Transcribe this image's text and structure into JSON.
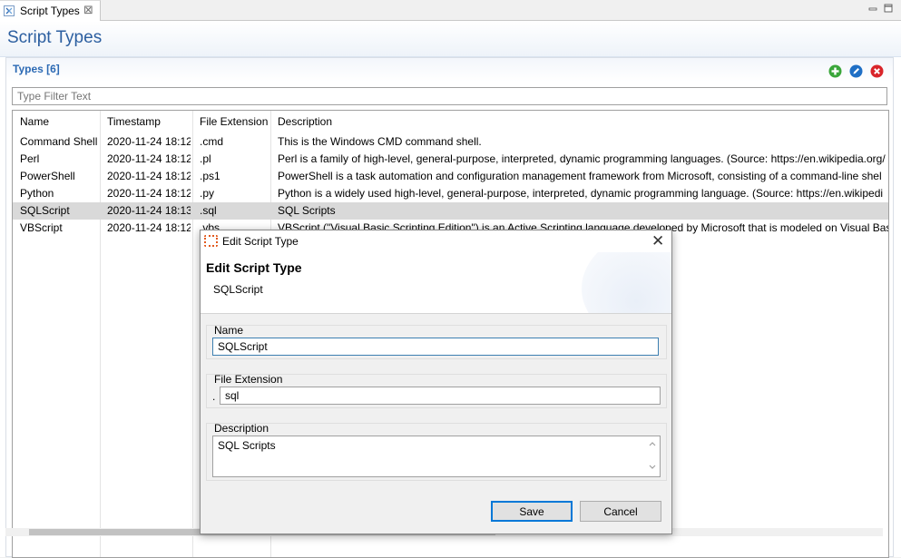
{
  "tab": {
    "label": "Script Types",
    "close_glyph": "⊠"
  },
  "page": {
    "title": "Script Types"
  },
  "section": {
    "title": "Types [6]"
  },
  "filter": {
    "placeholder": "Type Filter Text",
    "value": ""
  },
  "toolbar": {
    "add_icon": "plus-circle-icon",
    "edit_icon": "edit-icon",
    "delete_icon": "delete-icon",
    "colors": {
      "add": "#3aa63a",
      "edit": "#1f6fc5",
      "delete": "#d9252a"
    }
  },
  "table": {
    "columns": [
      "Name",
      "Timestamp",
      "File Extension",
      "Description"
    ],
    "rows": [
      {
        "name": "Command Shell",
        "timestamp": "2020-11-24 18:12",
        "ext": ".cmd",
        "description": "This is the Windows CMD command shell."
      },
      {
        "name": "Perl",
        "timestamp": "2020-11-24 18:12",
        "ext": ".pl",
        "description": "Perl is a family of high-level, general-purpose, interpreted, dynamic programming languages. (Source: https://en.wikipedia.org/"
      },
      {
        "name": "PowerShell",
        "timestamp": "2020-11-24 18:12",
        "ext": ".ps1",
        "description": "PowerShell is a task automation and configuration management framework from Microsoft, consisting of a command-line shel"
      },
      {
        "name": "Python",
        "timestamp": "2020-11-24 18:12",
        "ext": ".py",
        "description": "Python is a widely used high-level, general-purpose, interpreted, dynamic programming language. (Source: https://en.wikipedi"
      },
      {
        "name": "SQLScript",
        "timestamp": "2020-11-24 18:13",
        "ext": ".sql",
        "description": "SQL Scripts"
      },
      {
        "name": "VBScript",
        "timestamp": "2020-11-24 18:12",
        "ext": ".vbs",
        "description": "VBScript (\"Visual Basic Scripting Edition\") is an Active Scripting language developed by Microsoft that is modeled on Visual Basic"
      }
    ],
    "selected_row": "SQLScript",
    "selected_color": "#d9d9d9"
  },
  "dialog": {
    "window_title": "Edit Script Type",
    "heading": "Edit Script Type",
    "subheading": "SQLScript",
    "name_label": "Name",
    "name_value": "SQLScript",
    "ext_label": "File Extension",
    "ext_dot": ".",
    "ext_value": "sql",
    "desc_label": "Description",
    "desc_value": "SQL Scripts",
    "save_label": "Save",
    "cancel_label": "Cancel",
    "close_glyph": "✕"
  }
}
